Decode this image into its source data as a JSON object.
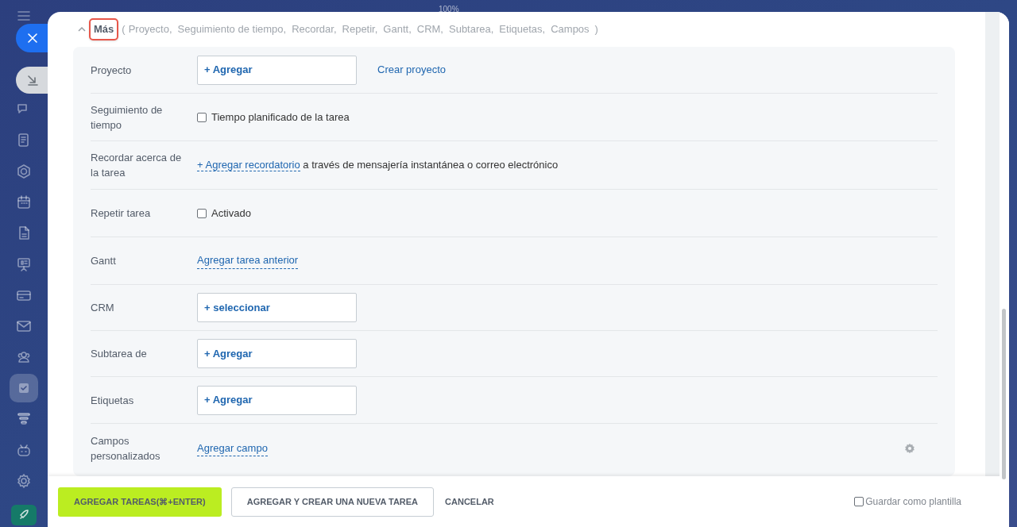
{
  "top_bar": {
    "zoom_label": "100%"
  },
  "sidebar": {
    "items": [
      {
        "kind": "chat",
        "selected": false
      },
      {
        "kind": "feed",
        "selected": false
      },
      {
        "kind": "hexagon",
        "selected": false
      },
      {
        "kind": "calendar",
        "selected": false
      },
      {
        "kind": "document",
        "selected": false
      },
      {
        "kind": "board",
        "selected": false
      },
      {
        "kind": "card",
        "selected": false
      },
      {
        "kind": "mail",
        "selected": false
      },
      {
        "kind": "people",
        "selected": false
      },
      {
        "kind": "tasks",
        "selected": true
      },
      {
        "kind": "filter",
        "selected": false
      },
      {
        "kind": "robot",
        "selected": false
      },
      {
        "kind": "settings",
        "selected": false
      }
    ]
  },
  "more": {
    "label": "Más",
    "expanded": true,
    "highlighted": true,
    "open_paren": "(",
    "close_paren": ")",
    "sections": [
      "Proyecto,",
      "Seguimiento de tiempo,",
      "Recordar,",
      "Repetir,",
      "Gantt,",
      "CRM,",
      "Subtarea,",
      "Etiquetas,",
      "Campos"
    ]
  },
  "rows": [
    {
      "kind": "picker",
      "label": "Proyecto",
      "button": "+ Agregar",
      "link": "Crear proyecto"
    },
    {
      "kind": "checkbox",
      "label": "Seguimiento de tiempo",
      "option": "Tiempo planificado de la tarea",
      "checked": false
    },
    {
      "kind": "reminder",
      "label": "Recordar acerca de la tarea",
      "link": "+ Agregar recordatorio",
      "text": "a través de mensajería instantánea o correo electrónico"
    },
    {
      "kind": "checkbox",
      "label": "Repetir tarea",
      "option": "Activado",
      "checked": false
    },
    {
      "kind": "link",
      "label": "Gantt",
      "link": "Agregar tarea anterior"
    },
    {
      "kind": "picker",
      "label": "CRM",
      "button": "+ seleccionar"
    },
    {
      "kind": "picker",
      "label": "Subtarea de",
      "button": "+ Agregar"
    },
    {
      "kind": "picker",
      "label": "Etiquetas",
      "button": "+ Agregar"
    },
    {
      "kind": "link",
      "label": "Campos personalizados",
      "link": "Agregar campo",
      "settings": true
    }
  ],
  "footer": {
    "primary": "AGREGAR TAREAS(⌘+ENTER)",
    "secondary": "AGREGAR Y CREAR UNA NUEVA TAREA",
    "cancel": "CANCELAR",
    "template": {
      "label": "Guardar como plantilla",
      "checked": false
    }
  }
}
